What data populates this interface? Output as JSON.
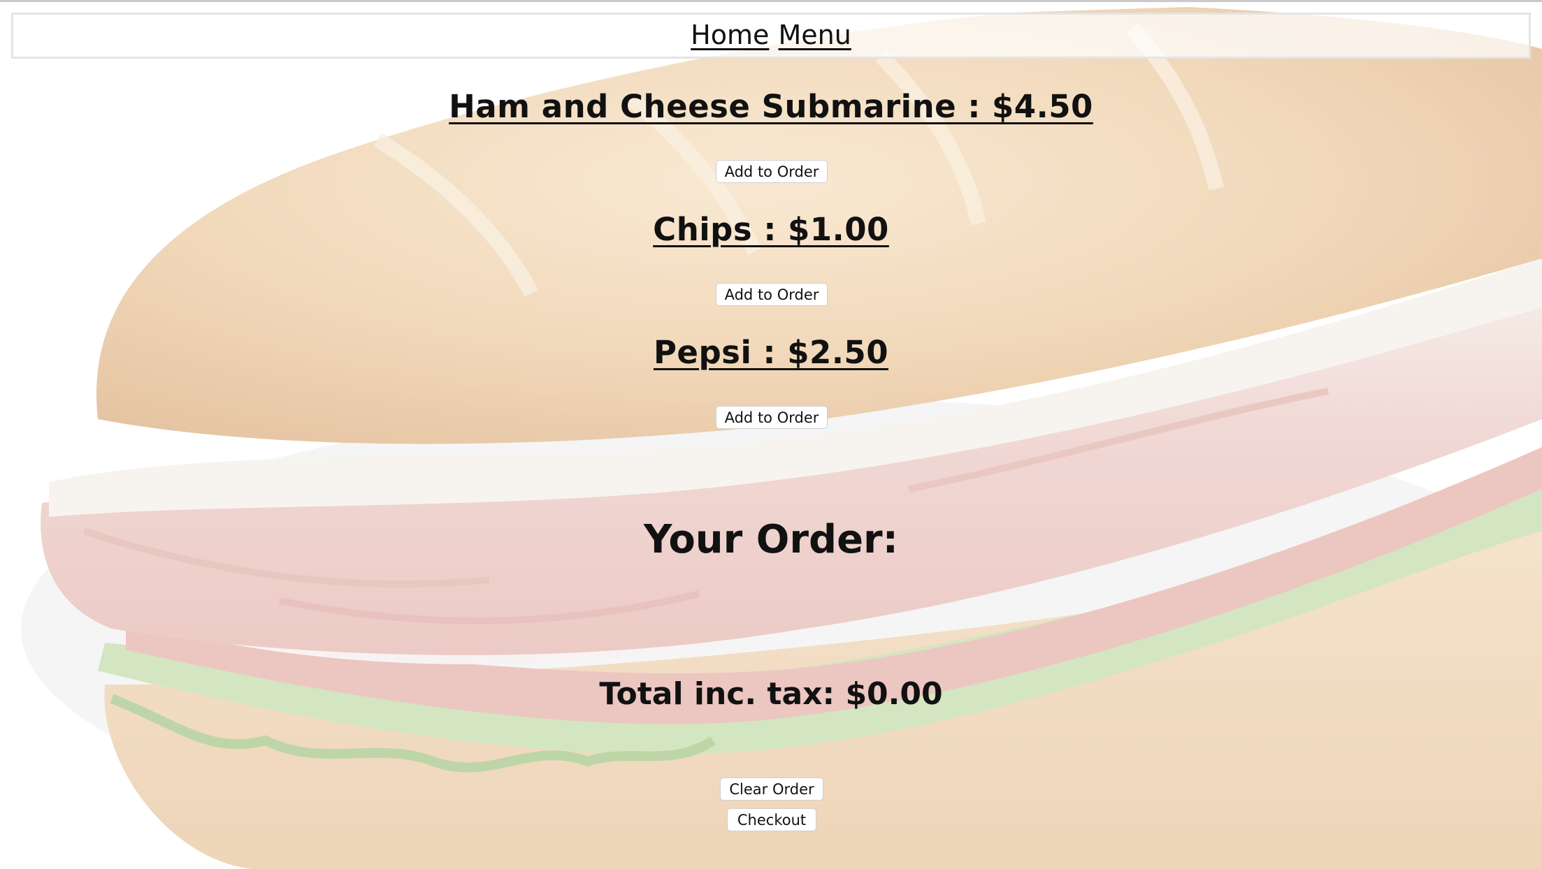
{
  "nav": {
    "home": "Home",
    "menu": "Menu"
  },
  "menu_items": [
    {
      "title": "Ham and Cheese Submarine : $4.50",
      "button": "Add to Order"
    },
    {
      "title": "Chips : $1.00",
      "button": "Add to Order"
    },
    {
      "title": "Pepsi : $2.50",
      "button": "Add to Order"
    }
  ],
  "order": {
    "heading": "Your Order:",
    "total": "Total inc. tax: $0.00",
    "clear_label": "Clear Order",
    "checkout_label": "Checkout"
  },
  "colors": {
    "text": "#111111",
    "bread": "#e9c9a2",
    "meat": "#e9c1bd",
    "cheese": "#f1ece2",
    "lettuce": "#b9d39b",
    "tomato": "#d89b93"
  }
}
